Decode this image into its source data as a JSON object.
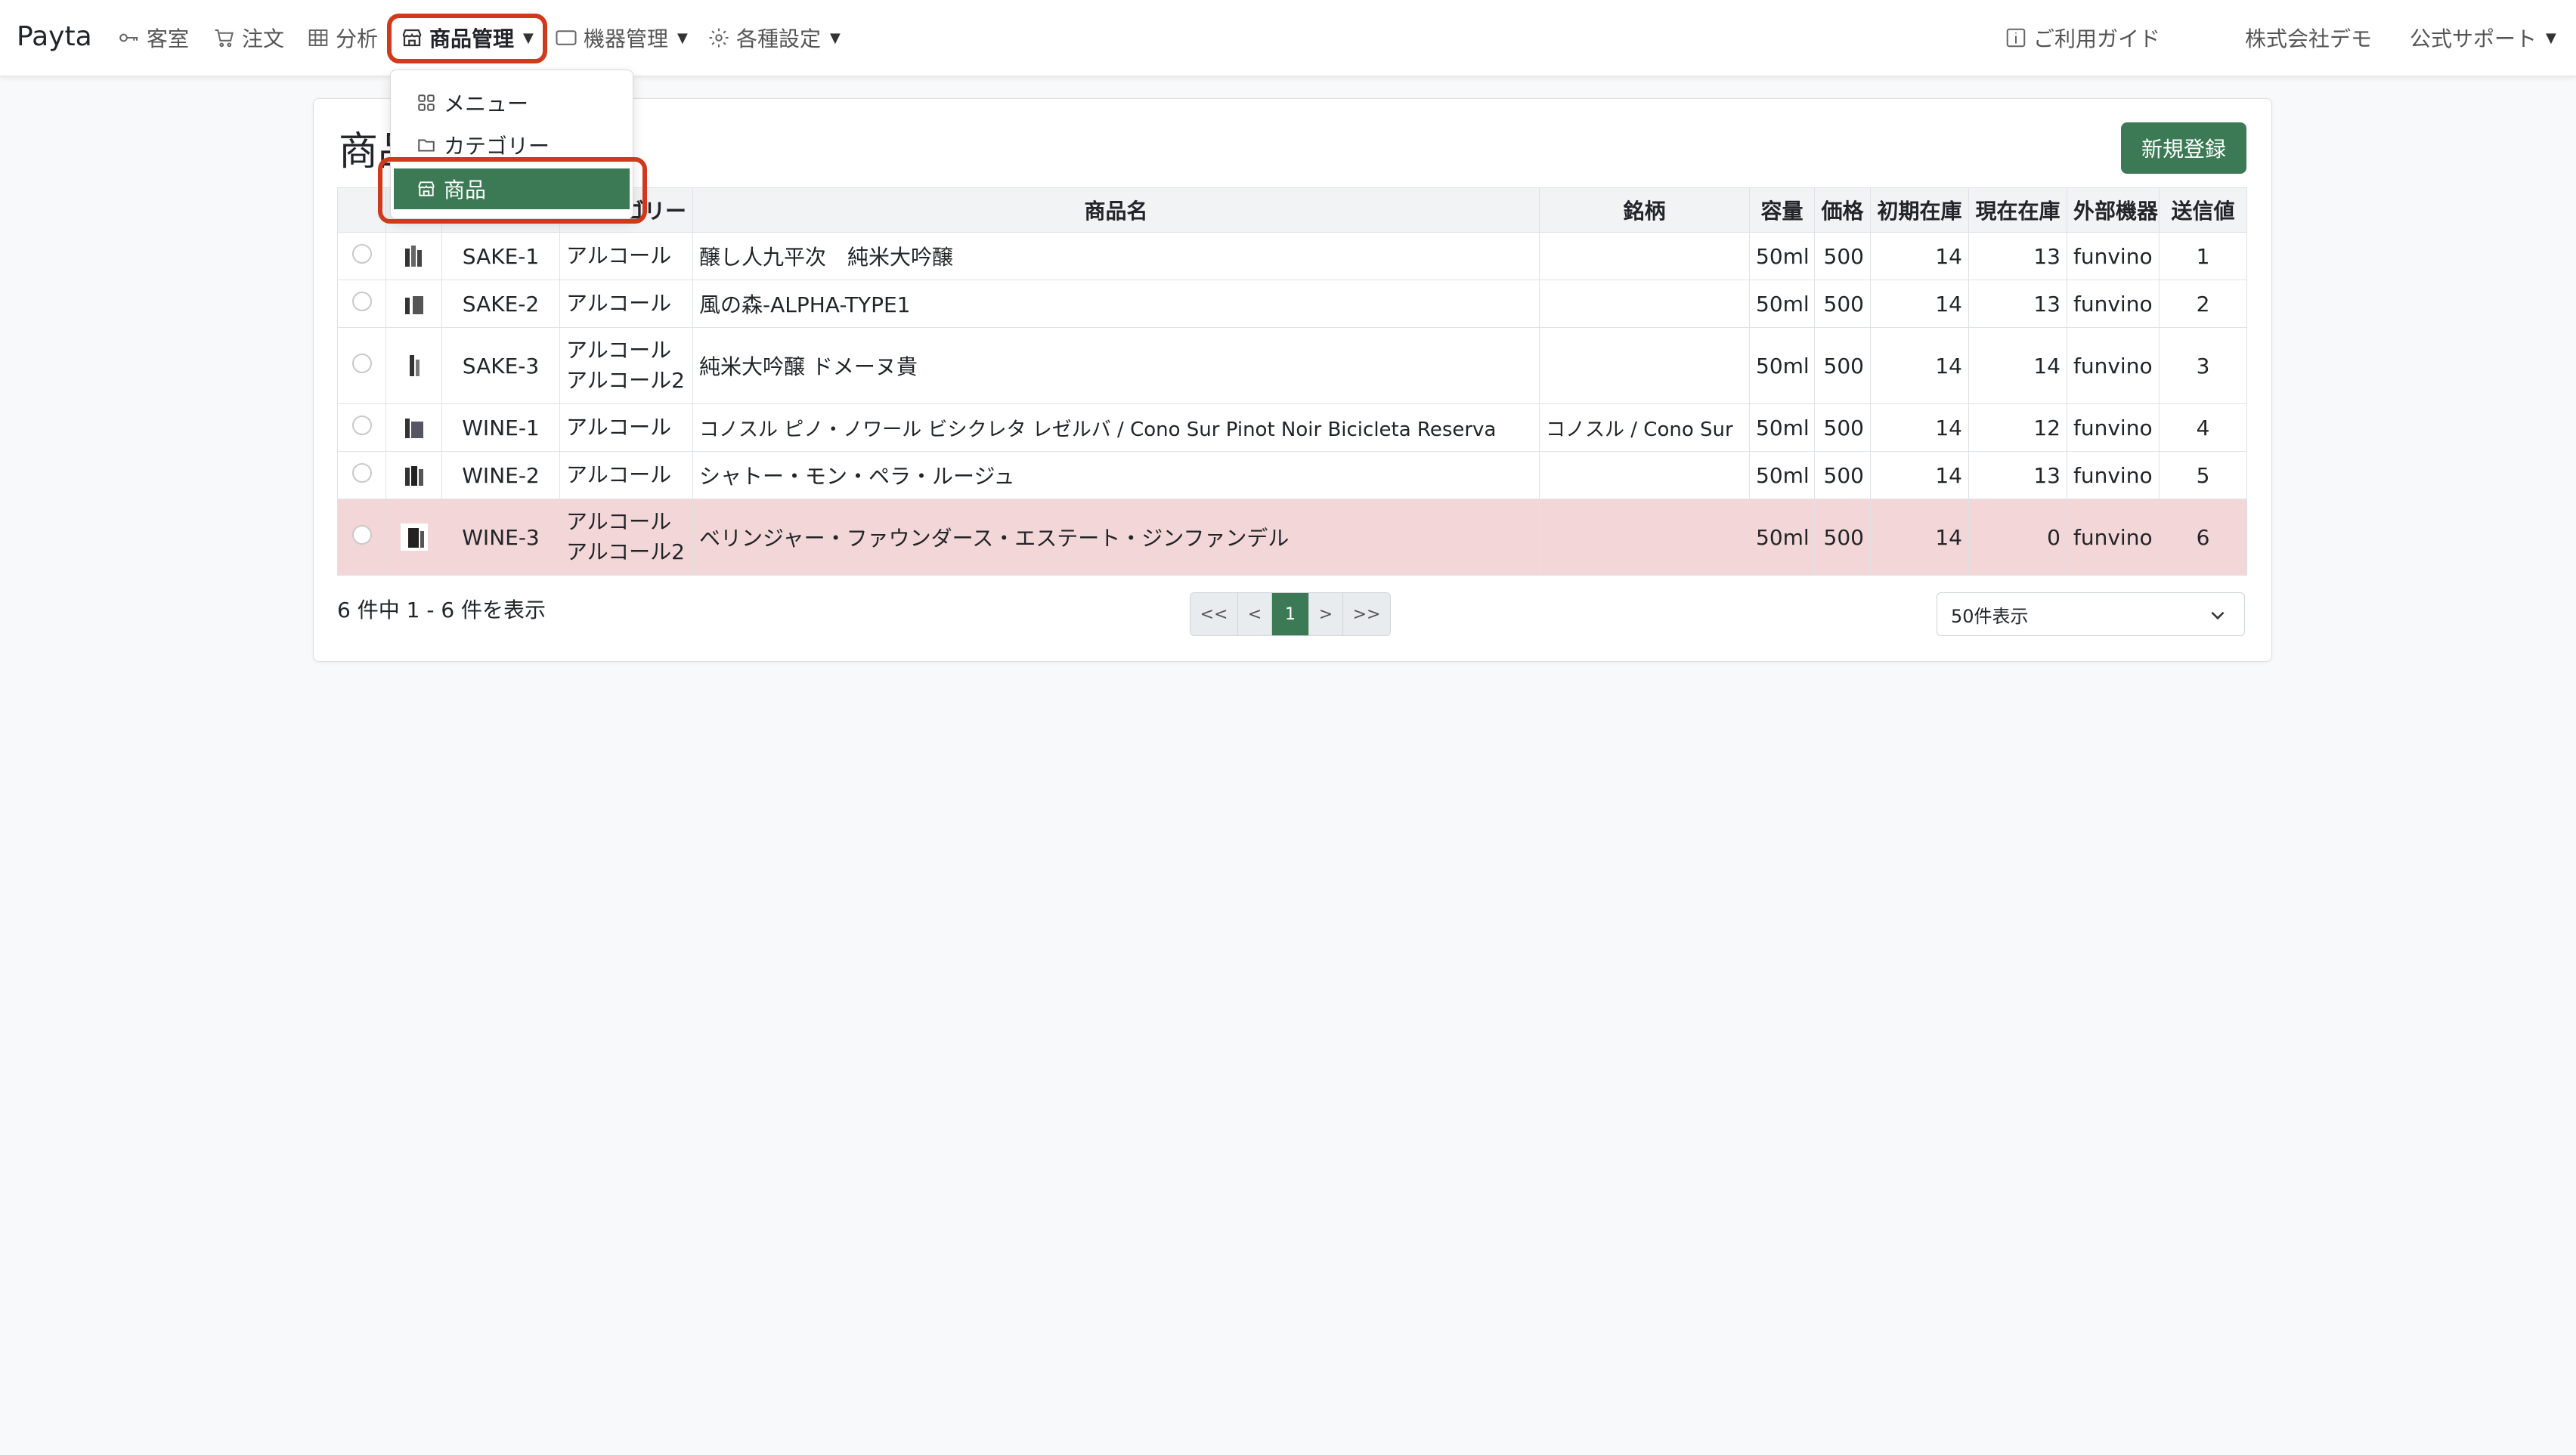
{
  "brand": "Payta",
  "nav": {
    "guest_room": "客室",
    "orders": "注文",
    "analytics": "分析",
    "product_mgmt": "商品管理",
    "device_mgmt": "機器管理",
    "settings": "各種設定",
    "guide": "ご利用ガイド",
    "company": "株式会社デモ",
    "support": "公式サポート"
  },
  "dropdown": {
    "items": [
      {
        "label": "メニュー",
        "icon": "grid-icon"
      },
      {
        "label": "カテゴリー",
        "icon": "folder-icon"
      },
      {
        "label": "商品",
        "icon": "shop-icon",
        "active": true
      }
    ]
  },
  "page": {
    "title": "商品",
    "new_button": "新規登録"
  },
  "table": {
    "headers": {
      "category": "ゴリー",
      "name": "商品名",
      "brand": "銘柄",
      "volume": "容量",
      "price": "価格",
      "initial_stock": "初期在庫",
      "current_stock": "現在在庫",
      "external_device": "外部機器",
      "send_value": "送信値"
    },
    "rows": [
      {
        "code": "SAKE-1",
        "cat1": "アルコール",
        "cat2": "",
        "name": "醸し人九平次　純米大吟醸",
        "brand": "",
        "volume": "50ml",
        "price": "500",
        "initial": "14",
        "current": "13",
        "device": "funvino",
        "send": "1"
      },
      {
        "code": "SAKE-2",
        "cat1": "アルコール",
        "cat2": "",
        "name": "風の森-ALPHA-TYPE1",
        "brand": "",
        "volume": "50ml",
        "price": "500",
        "initial": "14",
        "current": "13",
        "device": "funvino",
        "send": "2"
      },
      {
        "code": "SAKE-3",
        "cat1": "アルコール",
        "cat2": "アルコール2",
        "name": "純米大吟醸 ドメーヌ貴",
        "brand": "",
        "volume": "50ml",
        "price": "500",
        "initial": "14",
        "current": "14",
        "device": "funvino",
        "send": "3"
      },
      {
        "code": "WINE-1",
        "cat1": "アルコール",
        "cat2": "",
        "name": "コノスル ピノ・ノワール ビシクレタ レゼルバ / Cono Sur Pinot Noir Bicicleta Reserva",
        "brand": "コノスル / Cono Sur",
        "volume": "50ml",
        "price": "500",
        "initial": "14",
        "current": "12",
        "device": "funvino",
        "send": "4"
      },
      {
        "code": "WINE-2",
        "cat1": "アルコール",
        "cat2": "",
        "name": "シャトー・モン・ペラ・ルージュ",
        "brand": "",
        "volume": "50ml",
        "price": "500",
        "initial": "14",
        "current": "13",
        "device": "funvino",
        "send": "5"
      },
      {
        "code": "WINE-3",
        "cat1": "アルコール",
        "cat2": "アルコール2",
        "name": "ベリンジャー・ファウンダース・エステート・ジンファンデル",
        "brand": "",
        "volume": "50ml",
        "price": "500",
        "initial": "14",
        "current": "0",
        "device": "funvino",
        "send": "6"
      }
    ]
  },
  "footer": {
    "summary": "6 件中 1 - 6 件を表示",
    "pager": {
      "first": "<<",
      "prev": "<",
      "current": "1",
      "next": ">",
      "last": ">>"
    },
    "per_page": "50件表示"
  },
  "colors": {
    "accent": "#3c7a55",
    "highlight": "#d0391c",
    "danger_row": "#f3d6d8"
  }
}
